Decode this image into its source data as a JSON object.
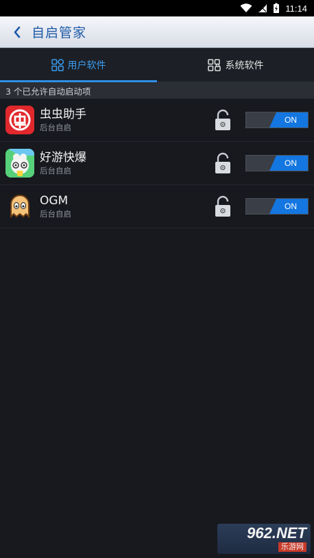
{
  "status_bar": {
    "time": "11:14"
  },
  "header": {
    "title": "自启管家"
  },
  "tabs": [
    {
      "label": "用户软件",
      "active": true
    },
    {
      "label": "系统软件",
      "active": false
    }
  ],
  "section": {
    "summary": "3 个已允许自动启动项"
  },
  "apps": [
    {
      "name": "虫虫助手",
      "subtitle": "后台自启",
      "toggle": "ON"
    },
    {
      "name": "好游快爆",
      "subtitle": "后台自启",
      "toggle": "ON"
    },
    {
      "name": "OGM",
      "subtitle": "后台自启",
      "toggle": "ON"
    }
  ],
  "watermark": {
    "top": "962.NET",
    "bottom": "乐游网"
  },
  "colors": {
    "accent": "#2f8fe6",
    "toggle_on": "#1476e0",
    "title_text": "#1e5aa8"
  }
}
